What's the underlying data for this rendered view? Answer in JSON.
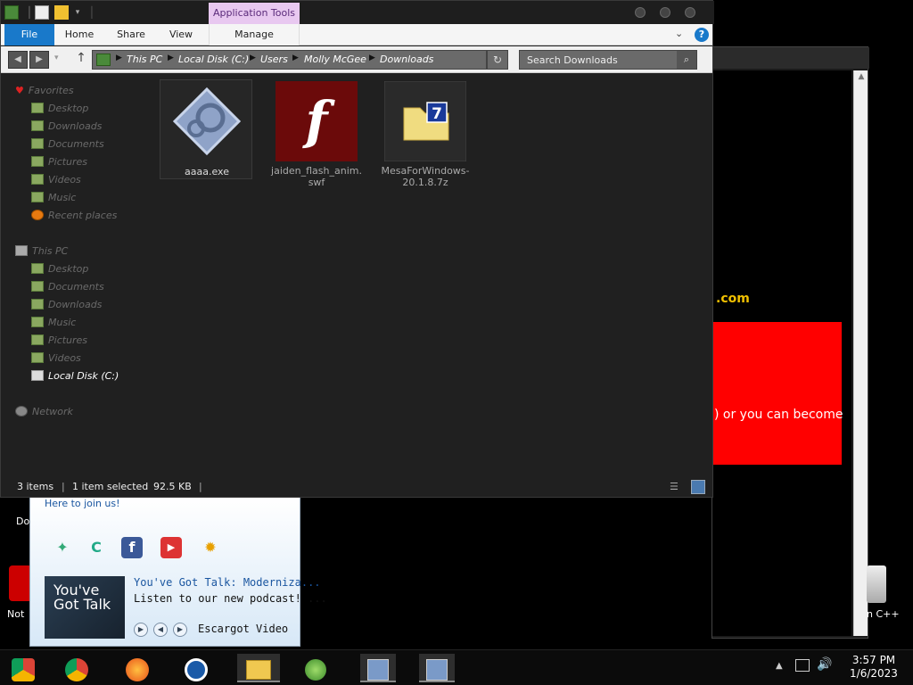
{
  "explorer": {
    "context_tab": "Application Tools",
    "ribbon_tabs": [
      "File",
      "Home",
      "Share",
      "View",
      "Manage"
    ],
    "breadcrumbs": [
      "This PC",
      "Local Disk (C:)",
      "Users",
      "Molly McGee",
      "Downloads"
    ],
    "search_placeholder": "Search Downloads",
    "nav": {
      "favorites_label": "Favorites",
      "favorites": [
        "Desktop",
        "Downloads",
        "Documents",
        "Pictures",
        "Videos",
        "Music",
        "Recent places"
      ],
      "thispc_label": "This PC",
      "thispc": [
        "Desktop",
        "Documents",
        "Downloads",
        "Music",
        "Pictures",
        "Videos",
        "Local Disk (C:)"
      ],
      "network_label": "Network"
    },
    "files": [
      {
        "name": "aaaa.exe",
        "icon": "exe-icon",
        "selected": true
      },
      {
        "name": "jaiden_flash_anim.swf",
        "icon": "flash-icon",
        "selected": false
      },
      {
        "name": "MesaForWindows-20.1.8.7z",
        "icon": "7z-archive-icon",
        "selected": false
      }
    ],
    "status": {
      "count": "3 items",
      "selection": "1 item selected",
      "size": "92.5 KB"
    }
  },
  "background": {
    "domain_fragment": ".com",
    "red_text": ") or you can become",
    "accent_red": "#ff0000",
    "accent_yellow": "#f0c000"
  },
  "desktop": {
    "left_label_1": "Do",
    "left_label_2": "Not",
    "right_label": "n C++"
  },
  "messenger": {
    "join_text": "Here to join us!",
    "thumb_text": "You've Got Talk",
    "news_title": "You've Got Talk: Moderniza...",
    "news_sub": "Listen to our new podcast! ...",
    "video_label": "Escargot Video"
  },
  "taskbar": {
    "time": "3:57 PM",
    "date": "1/6/2023"
  },
  "colors": {
    "accent_blue": "#1979ca",
    "context_tab_bg": "#e8c8f0"
  }
}
